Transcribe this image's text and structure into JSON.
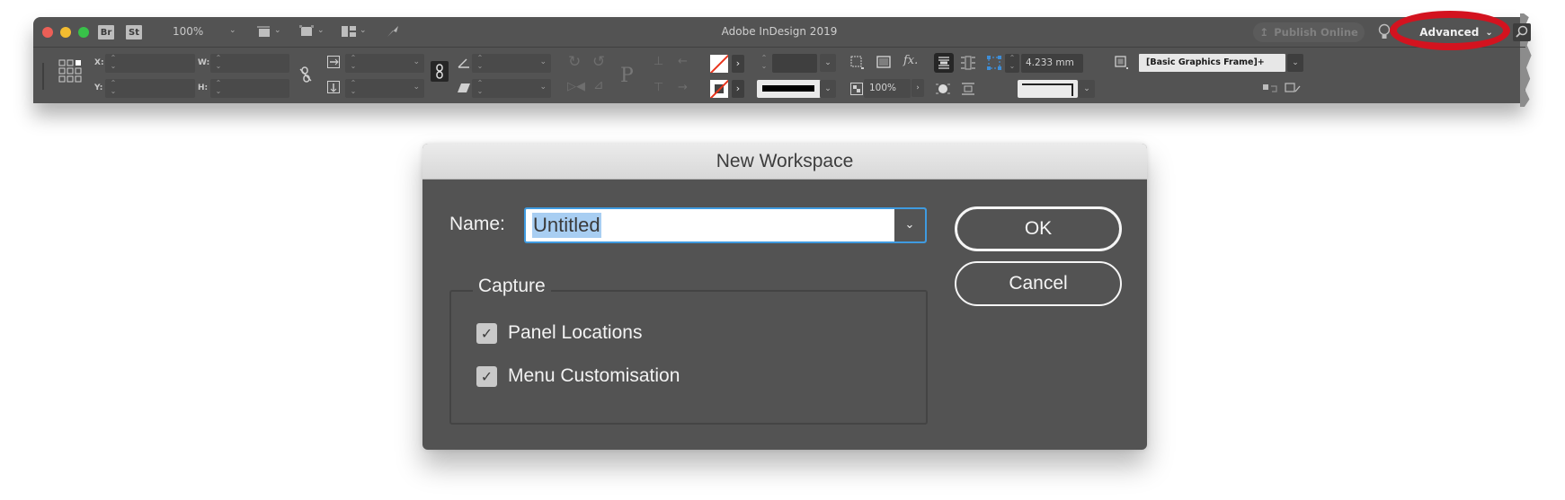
{
  "app": {
    "title": "Adobe InDesign 2019",
    "bridge_badge": "Br",
    "stock_badge": "St",
    "zoom_level": "100%",
    "publish_label": "Publish Online",
    "workspace_label": "Advanced",
    "highlight_color": "#d3131f"
  },
  "control_bar": {
    "x_label": "X:",
    "y_label": "Y:",
    "w_label": "W:",
    "h_label": "H:",
    "x_value": "",
    "y_value": "",
    "w_value": "",
    "h_value": "",
    "opacity_value": "100%",
    "stroke_weight_value": "",
    "offset_value": "4.233 mm",
    "object_style": "[Basic Graphics Frame]+",
    "fill_swatch": "none",
    "stroke_swatch": "none"
  },
  "dialog": {
    "title": "New Workspace",
    "name_label": "Name:",
    "name_value": "Untitled",
    "capture_legend": "Capture",
    "options": [
      {
        "label": "Panel Locations",
        "checked": true
      },
      {
        "label": "Menu Customisation",
        "checked": true
      }
    ],
    "ok_label": "OK",
    "cancel_label": "Cancel",
    "accent_color": "#3f9be0"
  }
}
